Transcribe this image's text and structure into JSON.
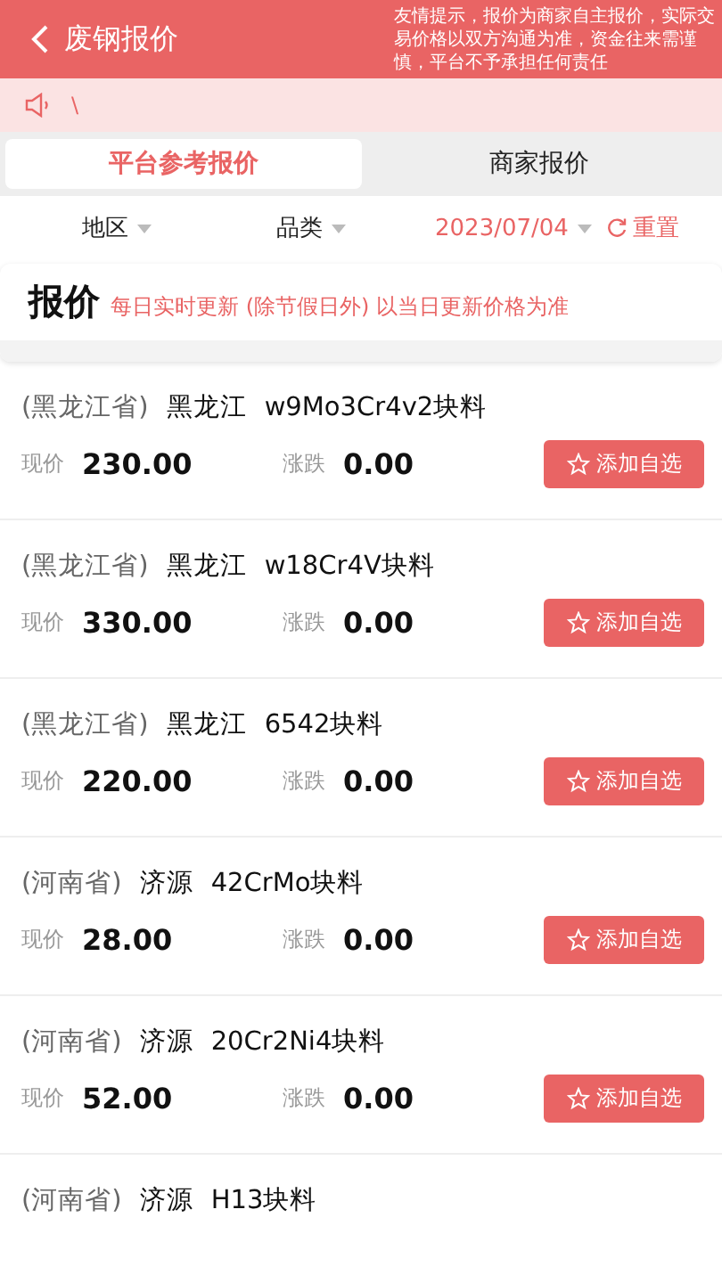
{
  "header": {
    "title": "废钢报价",
    "notice": "友情提示，报价为商家自主报价，实际交易价格以双方沟通为准，资金往来需谨慎，平台不予承担任何责任"
  },
  "announcement": {
    "text": "\\"
  },
  "tabs": [
    {
      "label": "平台参考报价",
      "selected": true
    },
    {
      "label": "商家报价",
      "selected": false
    }
  ],
  "filters": {
    "region": "地区",
    "category": "品类",
    "date": "2023/07/04",
    "reset": "重置"
  },
  "banner": {
    "title": "报价",
    "subtitle": "每日实时更新 (除节假日外) 以当日更新价格为准"
  },
  "quotes": [
    {
      "province": "(黑龙江省)",
      "city": "黑龙江",
      "product": "w9Mo3Cr4v2块料",
      "price_label": "现价",
      "price": "230.00",
      "change_label": "涨跌",
      "change": "0.00",
      "button": "添加自选"
    },
    {
      "province": "(黑龙江省)",
      "city": "黑龙江",
      "product": "w18Cr4V块料",
      "price_label": "现价",
      "price": "330.00",
      "change_label": "涨跌",
      "change": "0.00",
      "button": "添加自选"
    },
    {
      "province": "(黑龙江省)",
      "city": "黑龙江",
      "product": "6542块料",
      "price_label": "现价",
      "price": "220.00",
      "change_label": "涨跌",
      "change": "0.00",
      "button": "添加自选"
    },
    {
      "province": "(河南省)",
      "city": "济源",
      "product": "42CrMo块料",
      "price_label": "现价",
      "price": "28.00",
      "change_label": "涨跌",
      "change": "0.00",
      "button": "添加自选"
    },
    {
      "province": "(河南省)",
      "city": "济源",
      "product": "20Cr2Ni4块料",
      "price_label": "现价",
      "price": "52.00",
      "change_label": "涨跌",
      "change": "0.00",
      "button": "添加自选"
    },
    {
      "province": "(河南省)",
      "city": "济源",
      "product": "H13块料"
    }
  ]
}
